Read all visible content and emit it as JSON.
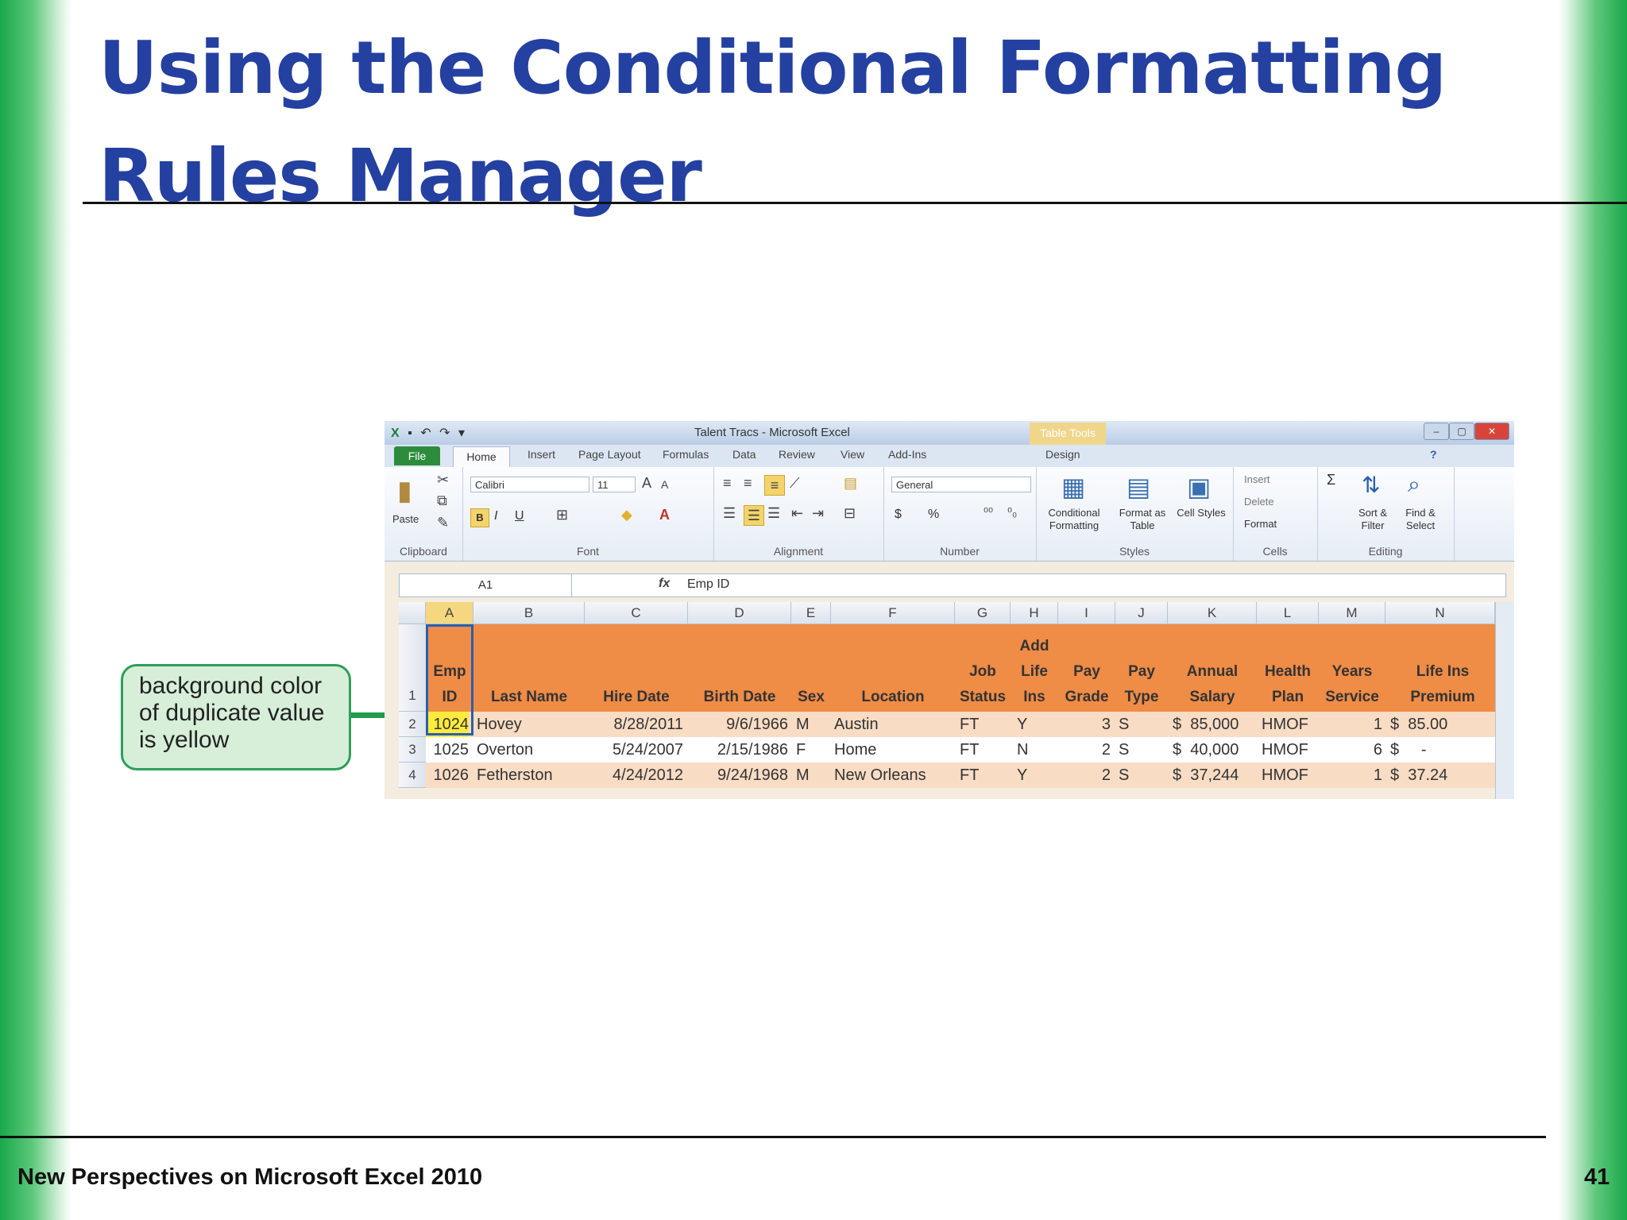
{
  "slide": {
    "title": "Using the Conditional Formatting Rules Manager",
    "footer": "New Perspectives on Microsoft Excel 2010",
    "page_number": "41",
    "callout": "background color of duplicate value is yellow"
  },
  "excel": {
    "window_title": "Talent Tracs - Microsoft Excel",
    "table_tools": "Table Tools",
    "tabs": [
      "File",
      "Home",
      "Insert",
      "Page Layout",
      "Formulas",
      "Data",
      "Review",
      "View",
      "Add-Ins",
      "Design"
    ],
    "ribbon": {
      "clipboard": {
        "label": "Clipboard",
        "paste": "Paste"
      },
      "font": {
        "label": "Font",
        "name": "Calibri",
        "size": "11",
        "bold": "B",
        "italic": "I",
        "underline": "U"
      },
      "alignment": {
        "label": "Alignment"
      },
      "number": {
        "label": "Number",
        "format": "General",
        "currency": "$",
        "percent": "%"
      },
      "styles": {
        "label": "Styles",
        "conditional_formatting": "Conditional Formatting",
        "format_as_table": "Format as Table",
        "cell_styles": "Cell Styles"
      },
      "cells": {
        "label": "Cells",
        "insert": "Insert",
        "delete": "Delete",
        "format": "Format"
      },
      "editing": {
        "label": "Editing",
        "sort_filter": "Sort & Filter",
        "find_select": "Find & Select",
        "sigma": "Σ"
      }
    },
    "name_box": "A1",
    "formula": "Emp ID",
    "fx": "fx",
    "columns": [
      "A",
      "B",
      "C",
      "D",
      "E",
      "F",
      "G",
      "H",
      "I",
      "J",
      "K",
      "L",
      "M",
      "N"
    ],
    "row_numbers": [
      "1",
      "2",
      "3",
      "4"
    ],
    "headers": [
      "Emp ID",
      "Last Name",
      "Hire Date",
      "Birth Date",
      "Sex",
      "Location",
      "Job Status",
      "Add Life Ins",
      "Pay Grade",
      "Pay Type",
      "Annual Salary",
      "Health Plan",
      "Years Service",
      "Life Ins Premium"
    ],
    "rows": [
      [
        "1024",
        "Hovey",
        "8/28/2011",
        "9/6/1966",
        "M",
        "Austin",
        "FT",
        "Y",
        "3",
        "S",
        "$  85,000",
        "HMOF",
        "1",
        "$  85.00"
      ],
      [
        "1025",
        "Overton",
        "5/24/2007",
        "2/15/1986",
        "F",
        "Home",
        "FT",
        "N",
        "2",
        "S",
        "$  40,000",
        "HMOF",
        "6",
        "$     -"
      ],
      [
        "1026",
        "Fetherston",
        "4/24/2012",
        "9/24/1968",
        "M",
        "New Orleans",
        "FT",
        "Y",
        "2",
        "S",
        "$  37,244",
        "HMOF",
        "1",
        "$  37.24"
      ]
    ],
    "colors": {
      "header_fill": "#ef8c46",
      "duplicate_fill": "#ffeb3b",
      "selection": "#2a5fae"
    }
  }
}
